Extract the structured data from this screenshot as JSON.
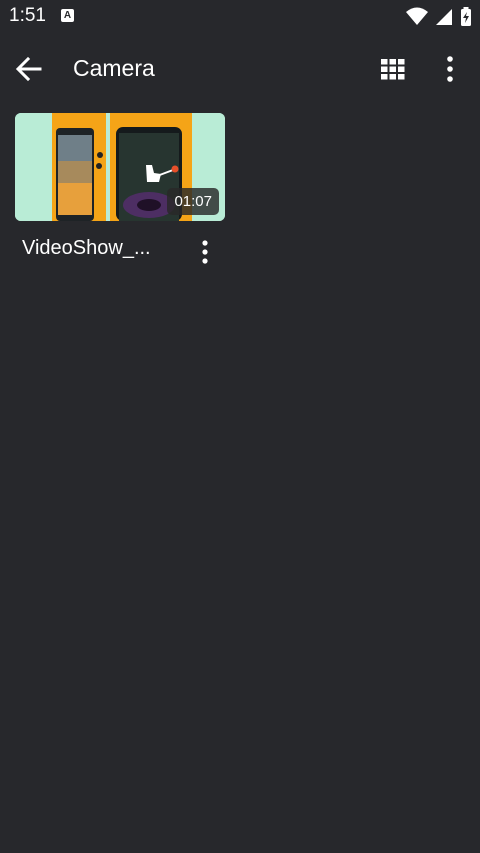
{
  "status_bar": {
    "time": "1:51",
    "badge_letter": "A",
    "icons": [
      "wifi-icon",
      "cell-signal-icon",
      "battery-charging-icon"
    ]
  },
  "app_bar": {
    "title": "Camera",
    "back_icon": "arrow-left-icon",
    "grid_icon": "grid-view-icon",
    "more_icon": "more-vertical-icon"
  },
  "videos": [
    {
      "name": "VideoShow_...",
      "duration": "01:07",
      "more_icon": "more-vertical-icon"
    }
  ],
  "colors": {
    "background": "#27282c",
    "thumbnail_bg": "#b9ecd6",
    "thumbnail_accent": "#f5a417"
  }
}
